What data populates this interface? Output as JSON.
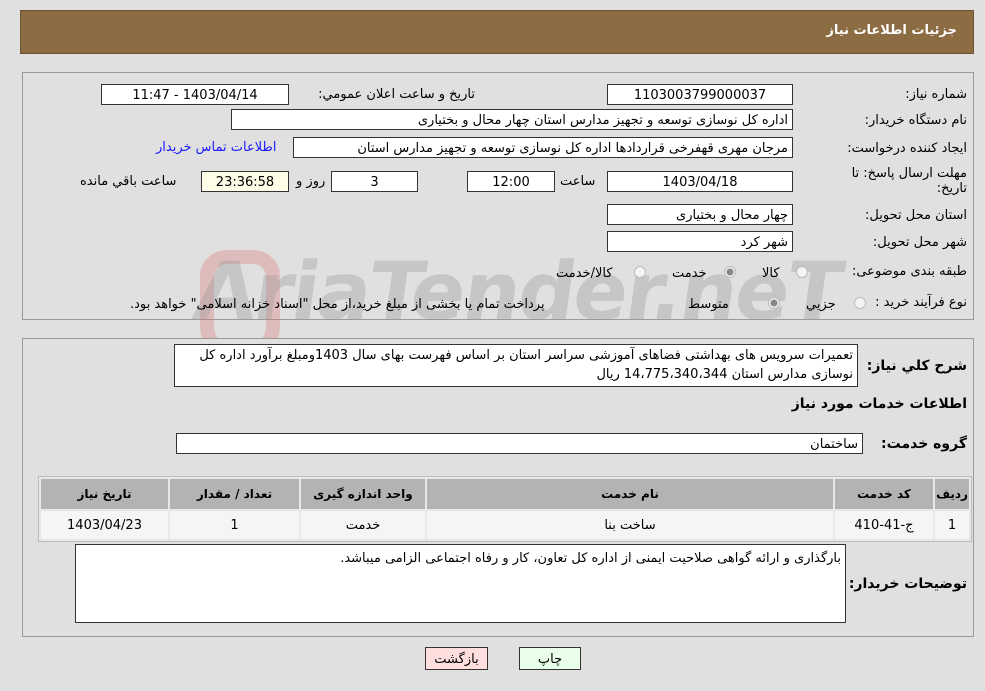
{
  "header": {
    "title": "جزئیات اطلاعات نیاز"
  },
  "form": {
    "need_number_label": "شماره نیاز:",
    "need_number": "1103003799000037",
    "announce_label": "تاریخ و ساعت اعلان عمومي:",
    "announce_value": "1403/04/14 - 11:47",
    "buyer_org_label": "نام دستگاه خریدار:",
    "buyer_org": "اداره کل نوسازی  توسعه و تجهیز مدارس استان چهار محال و بختیاری",
    "creator_label": "ایجاد کننده درخواست:",
    "creator": "مرجان مهری قهفرخی قراردادها اداره کل نوسازی  توسعه و تجهیز مدارس استان",
    "contact_link": "اطلاعات تماس خریدار",
    "deadline_label": "مهلت ارسال پاسخ: تا تاریخ:",
    "deadline_date": "1403/04/18",
    "time_label": "ساعت",
    "deadline_time": "12:00",
    "days": "3",
    "days_label": "روز و",
    "remaining": "23:36:58",
    "remaining_label": "ساعت باقي مانده",
    "province_label": "استان محل تحویل:",
    "province": "چهار محال و بختیاری",
    "city_label": "شهر محل تحویل:",
    "city": "شهر کرد",
    "category_label": "طبقه بندی موضوعی:",
    "category_options": [
      "کالا",
      "خدمت",
      "کالا/خدمت"
    ],
    "category_selected": "خدمت",
    "process_label": "نوع فرآیند خرید :",
    "process_options": [
      "جزیي",
      "متوسط"
    ],
    "process_selected": "متوسط",
    "process_note": "پرداخت تمام یا بخشی از مبلغ خرید،از محل \"اسناد خزانه اسلامی\" خواهد بود."
  },
  "watermark": "AriaTender.neT",
  "details": {
    "summary_label": "شرح کلي نیاز:",
    "summary": "تعمیرات سرویس های بهداشتی فضاهای آموزشی سراسر استان بر اساس فهرست بهای سال 1403ومبلغ برآورد اداره کل نوسازی مدارس استان 14،775،340،344 ریال",
    "services_title": "اطلاعات خدمات مورد نیاز",
    "service_group_label": "گروه خدمت:",
    "service_group": "ساختمان",
    "table": {
      "headers": [
        "ردیف",
        "کد خدمت",
        "نام خدمت",
        "واحد اندازه گیری",
        "تعداد / مقدار",
        "تاریخ نیاز"
      ],
      "rows": [
        [
          "1",
          "ج-41-410",
          "ساخت بنا",
          "خدمت",
          "1",
          "1403/04/23"
        ]
      ]
    },
    "notes_label": "توضیحات خریدار:",
    "notes": "بارگذاری و ارائه گواهی صلاحیت ایمنی از اداره کل تعاون، کار و رفاه اجتماعی الزامی میباشد."
  },
  "buttons": {
    "print": "چاپ",
    "back": "بازگشت"
  },
  "colors": {
    "header": "#8b6c43",
    "print_bg": "#eaffea",
    "back_bg": "#ffdede",
    "link": "#1a1aff"
  }
}
